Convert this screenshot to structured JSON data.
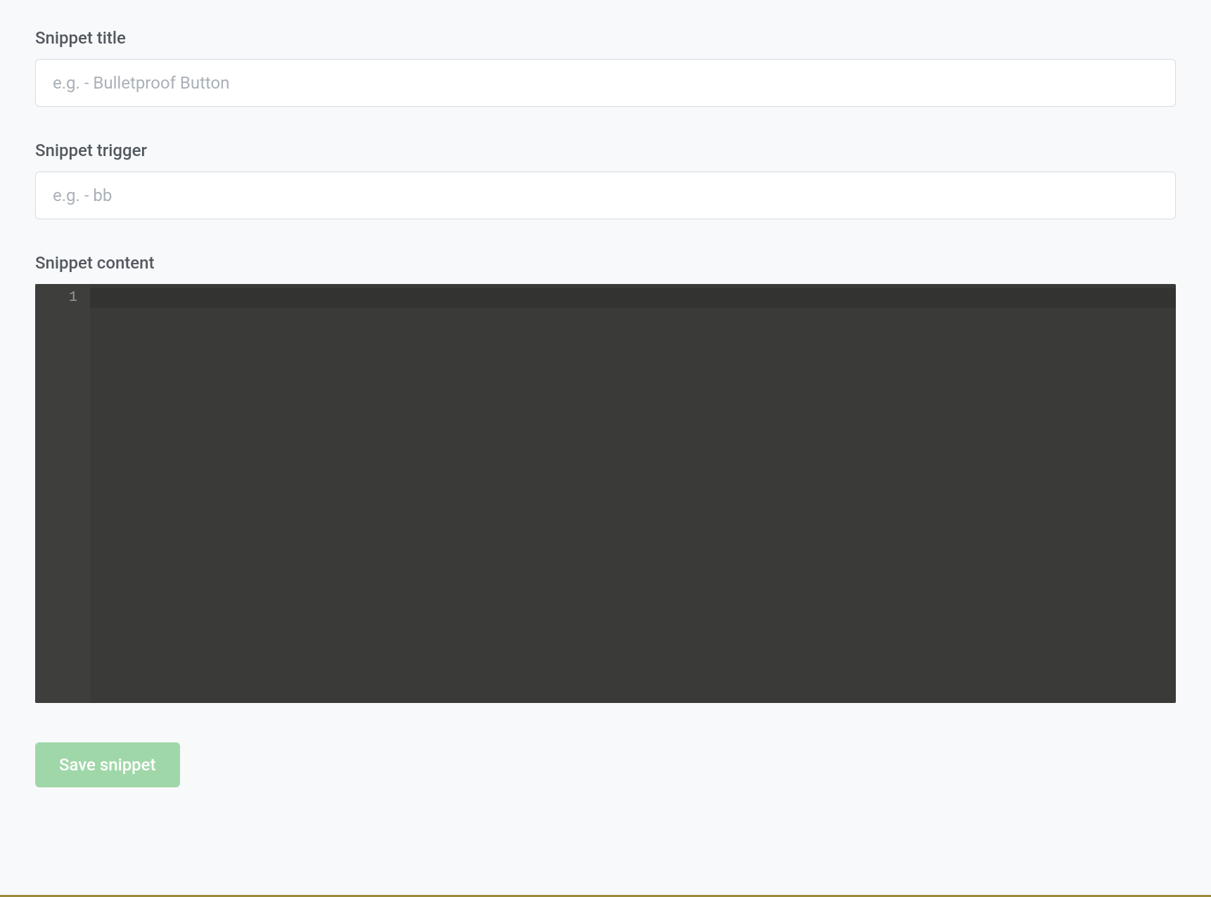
{
  "form": {
    "title": {
      "label": "Snippet title",
      "placeholder": "e.g. - Bulletproof Button",
      "value": ""
    },
    "trigger": {
      "label": "Snippet trigger",
      "placeholder": "e.g. - bb",
      "value": ""
    },
    "content": {
      "label": "Snippet content",
      "value": "",
      "line_numbers": [
        "1"
      ]
    },
    "save_button_label": "Save snippet"
  }
}
